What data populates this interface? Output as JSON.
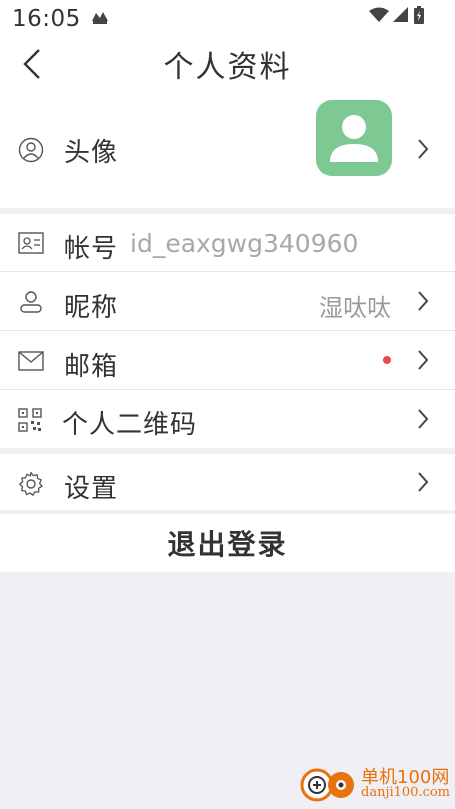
{
  "status_bar": {
    "time": "16:05"
  },
  "header": {
    "title": "个人资料"
  },
  "profile": {
    "avatar_label": "头像",
    "account_label": "帐号",
    "account_value": "id_eaxgwg340960",
    "nickname_label": "昵称",
    "nickname_value": "湿呔呔",
    "mailbox_label": "邮箱",
    "qrcode_label": "个人二维码"
  },
  "settings": {
    "label": "设置"
  },
  "logout": {
    "label": "退出登录"
  },
  "colors": {
    "avatar_bg": "#7ec894",
    "badge_red": "#e94b4b",
    "background": "#efeff4"
  },
  "watermark": {
    "line1": "单机100网",
    "line2": "danji100.com"
  }
}
